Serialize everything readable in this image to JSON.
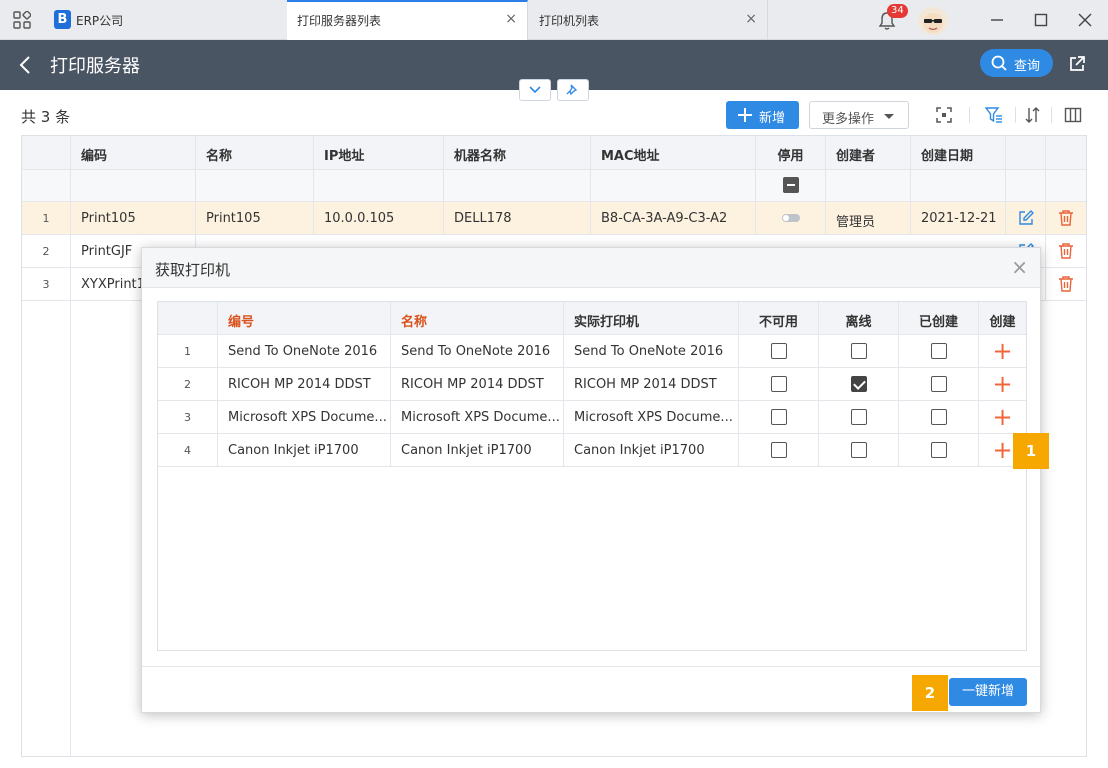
{
  "titlebar": {
    "company": "ERP公司",
    "logo_letter": "B",
    "tabs": [
      {
        "label": "打印服务器列表",
        "active": true
      },
      {
        "label": "打印机列表",
        "active": false
      }
    ],
    "close_glyph": "×",
    "notification_count": "34"
  },
  "header": {
    "title": "打印服务器",
    "query_label": "查询"
  },
  "toolbar": {
    "count_text": "共 3 条",
    "new_label": "新增",
    "more_label": "更多操作"
  },
  "grid": {
    "columns": [
      "编码",
      "名称",
      "IP地址",
      "机器名称",
      "MAC地址",
      "停用",
      "创建者",
      "创建日期"
    ],
    "rows": [
      {
        "num": "1",
        "code": "Print105",
        "name": "Print105",
        "ip": "10.0.0.105",
        "machine": "DELL178",
        "mac": "B8-CA-3A-A9-C3-A2",
        "creator": "管理员",
        "date": "2021-12-21"
      },
      {
        "num": "2",
        "code": "PrintGJF",
        "name": "",
        "ip": "",
        "machine": "",
        "mac": "",
        "creator": "",
        "date": ""
      },
      {
        "num": "3",
        "code": "XYXPrint1",
        "name": "",
        "ip": "",
        "machine": "",
        "mac": "",
        "creator": "",
        "date": ""
      }
    ]
  },
  "modal": {
    "title": "获取打印机",
    "close_glyph": "×",
    "columns": [
      "编号",
      "名称",
      "实际打印机",
      "不可用",
      "离线",
      "已创建",
      "创建"
    ],
    "rows": [
      {
        "num": "1",
        "code": "Send To OneNote 2016",
        "name": "Send To OneNote 2016",
        "printer": "Send To OneNote 2016",
        "unavailable": false,
        "offline": false,
        "created": false
      },
      {
        "num": "2",
        "code": "RICOH MP 2014 DDST",
        "name": "RICOH MP 2014 DDST",
        "printer": "RICOH MP 2014 DDST",
        "unavailable": false,
        "offline": true,
        "created": false
      },
      {
        "num": "3",
        "code": "Microsoft XPS Docume...",
        "name": "Microsoft XPS Docume...",
        "printer": "Microsoft XPS Docume...",
        "unavailable": false,
        "offline": false,
        "created": false
      },
      {
        "num": "4",
        "code": "Canon Inkjet iP1700",
        "name": "Canon Inkjet iP1700",
        "printer": "Canon Inkjet iP1700",
        "unavailable": false,
        "offline": false,
        "created": false
      }
    ],
    "add_glyph": "+",
    "batch_add_label": "一键新增"
  },
  "markers": [
    "1",
    "2"
  ],
  "colors": {
    "accent": "#2f8ae3",
    "header_bg": "#4a5563",
    "selected_row": "#fdf2e0",
    "delete_icon": "#e8643c",
    "edit_icon": "#2f8ae3",
    "marker": "#f7a800",
    "required_header": "#d9531e"
  },
  "icons": [
    "apps-grid-icon",
    "bell-icon",
    "minimize-icon",
    "maximize-icon",
    "close-icon",
    "back-arrow-icon",
    "search-icon",
    "export-icon",
    "chevron-down-icon",
    "pin-icon",
    "plus-icon",
    "fullscreen-icon",
    "filter-icon",
    "sort-icon",
    "columns-icon",
    "edit-icon",
    "delete-icon"
  ]
}
